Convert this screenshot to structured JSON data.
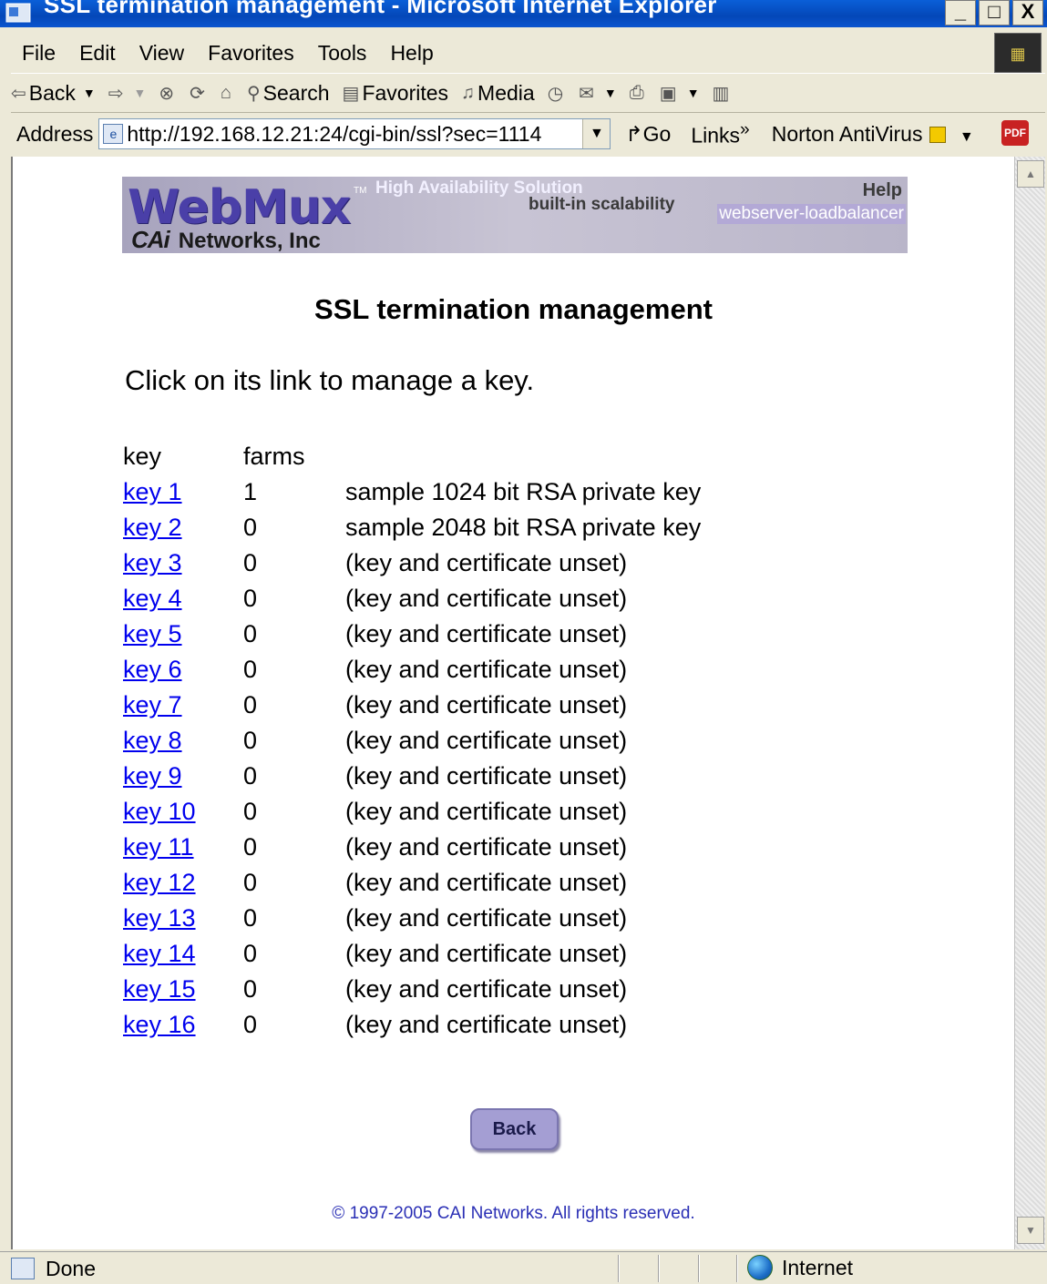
{
  "window": {
    "title": "SSL termination management - Microsoft Internet Explorer",
    "controls": [
      "_",
      "□",
      "X"
    ]
  },
  "menu": [
    "File",
    "Edit",
    "View",
    "Favorites",
    "Tools",
    "Help"
  ],
  "toolbar": {
    "back": "Back",
    "search": "Search",
    "favorites": "Favorites",
    "media": "Media"
  },
  "address": {
    "label": "Address",
    "url": "http://192.168.12.21:24/cgi-bin/ssl?sec=1114",
    "go": "Go",
    "links": "Links",
    "links_chevron": "»",
    "norton": "Norton AntiVirus"
  },
  "banner": {
    "logo": "WebMux",
    "tm": "TM",
    "tagline1": "High Availability Solution",
    "tagline2": "built-in scalability",
    "help": "Help",
    "subtag": "webserver-loadbalancer",
    "company_mark": "CAi",
    "company": "Networks, Inc"
  },
  "page": {
    "heading": "SSL termination management",
    "instruction": "Click on its link to manage a key.",
    "columns": [
      "key",
      "farms"
    ],
    "rows": [
      {
        "key": "key 1",
        "farms": "1",
        "desc": "sample 1024 bit RSA private key"
      },
      {
        "key": "key 2",
        "farms": "0",
        "desc": "sample 2048 bit RSA private key"
      },
      {
        "key": "key 3",
        "farms": "0",
        "desc": "(key and certificate unset)"
      },
      {
        "key": "key 4",
        "farms": "0",
        "desc": "(key and certificate unset)"
      },
      {
        "key": "key 5",
        "farms": "0",
        "desc": "(key and certificate unset)"
      },
      {
        "key": "key 6",
        "farms": "0",
        "desc": "(key and certificate unset)"
      },
      {
        "key": "key 7",
        "farms": "0",
        "desc": "(key and certificate unset)"
      },
      {
        "key": "key 8",
        "farms": "0",
        "desc": "(key and certificate unset)"
      },
      {
        "key": "key 9",
        "farms": "0",
        "desc": "(key and certificate unset)"
      },
      {
        "key": "key 10",
        "farms": "0",
        "desc": "(key and certificate unset)"
      },
      {
        "key": "key 11",
        "farms": "0",
        "desc": "(key and certificate unset)"
      },
      {
        "key": "key 12",
        "farms": "0",
        "desc": "(key and certificate unset)"
      },
      {
        "key": "key 13",
        "farms": "0",
        "desc": "(key and certificate unset)"
      },
      {
        "key": "key 14",
        "farms": "0",
        "desc": "(key and certificate unset)"
      },
      {
        "key": "key 15",
        "farms": "0",
        "desc": "(key and certificate unset)"
      },
      {
        "key": "key 16",
        "farms": "0",
        "desc": "(key and certificate unset)"
      }
    ],
    "back_button": "Back",
    "footer": "© 1997-2005 CAI Networks. All rights reserved."
  },
  "status": {
    "text": "Done",
    "zone": "Internet"
  },
  "colors": {
    "link": "#0000ee",
    "titlebar": "#0447b8",
    "button": "#a49ed3",
    "footer_text": "#2a2fb5"
  }
}
